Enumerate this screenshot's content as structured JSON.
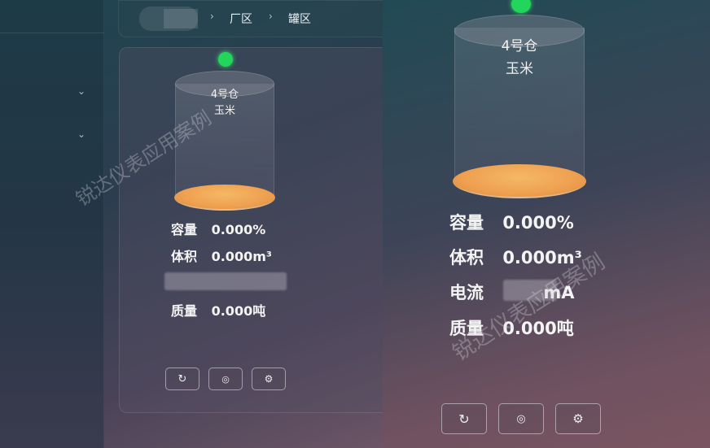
{
  "breadcrumb": {
    "items": [
      "厂区",
      "罐区"
    ],
    "separator": "›"
  },
  "left_card": {
    "tank": {
      "name": "4号仓",
      "material": "玉米",
      "status_color": "#21d65a"
    },
    "metrics": [
      {
        "key": "容量",
        "value": "0.000%"
      },
      {
        "key": "体积",
        "value": "0.000m³"
      },
      {
        "key": "质量",
        "value": "0.000吨"
      }
    ],
    "buttons": [
      {
        "icon": "refresh-icon",
        "glyph": "↻"
      },
      {
        "icon": "target-icon",
        "glyph": "◎"
      },
      {
        "icon": "gear-icon",
        "glyph": "⚙"
      }
    ]
  },
  "right_card": {
    "tank": {
      "name": "4号仓",
      "material": "玉米",
      "status_color": "#21d65a"
    },
    "metrics": [
      {
        "key": "容量",
        "value": "0.000%"
      },
      {
        "key": "体积",
        "value": "0.000m³"
      },
      {
        "key": "电流",
        "value": "mA"
      },
      {
        "key": "质量",
        "value": "0.000吨"
      }
    ],
    "buttons": [
      {
        "icon": "refresh-icon",
        "glyph": "↻"
      },
      {
        "icon": "target-icon",
        "glyph": "◎"
      },
      {
        "icon": "gear-icon",
        "glyph": "⚙"
      }
    ]
  },
  "watermark": "锐达仪表应用案例",
  "sidebar": {
    "chevrons": [
      "⌄",
      "⌄"
    ]
  }
}
